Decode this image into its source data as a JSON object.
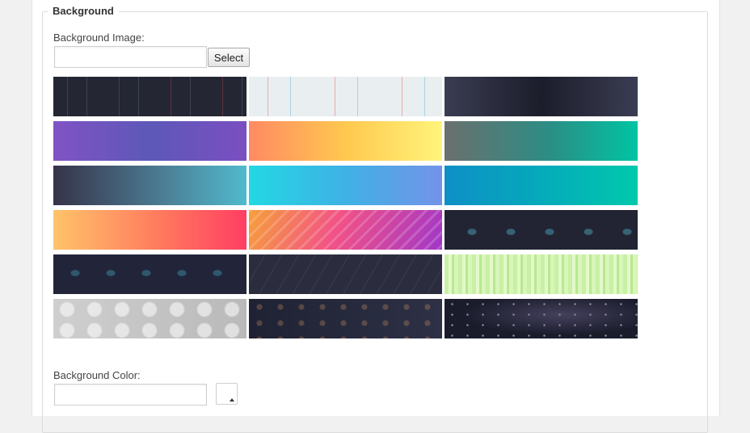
{
  "section": {
    "legend": "Background"
  },
  "background_image": {
    "label": "Background Image:",
    "value": "",
    "select_label": "Select"
  },
  "background_color": {
    "label": "Background Color:",
    "value": ""
  },
  "tiles": [
    {
      "name": "dark-lines"
    },
    {
      "name": "light-lines"
    },
    {
      "name": "dark-gradient"
    },
    {
      "name": "purple-gradient"
    },
    {
      "name": "orange-yellow-gradient"
    },
    {
      "name": "gray-teal-gradient"
    },
    {
      "name": "navy-cyan-gradient"
    },
    {
      "name": "cyan-blue-gradient"
    },
    {
      "name": "blue-teal-gradient"
    },
    {
      "name": "orange-red-gradient"
    },
    {
      "name": "neon-streaks"
    },
    {
      "name": "dark-squares"
    },
    {
      "name": "dark-squares-2"
    },
    {
      "name": "dark-rain"
    },
    {
      "name": "green-stripes"
    },
    {
      "name": "silver-bokeh"
    },
    {
      "name": "dark-bokeh"
    },
    {
      "name": "galaxy"
    }
  ]
}
